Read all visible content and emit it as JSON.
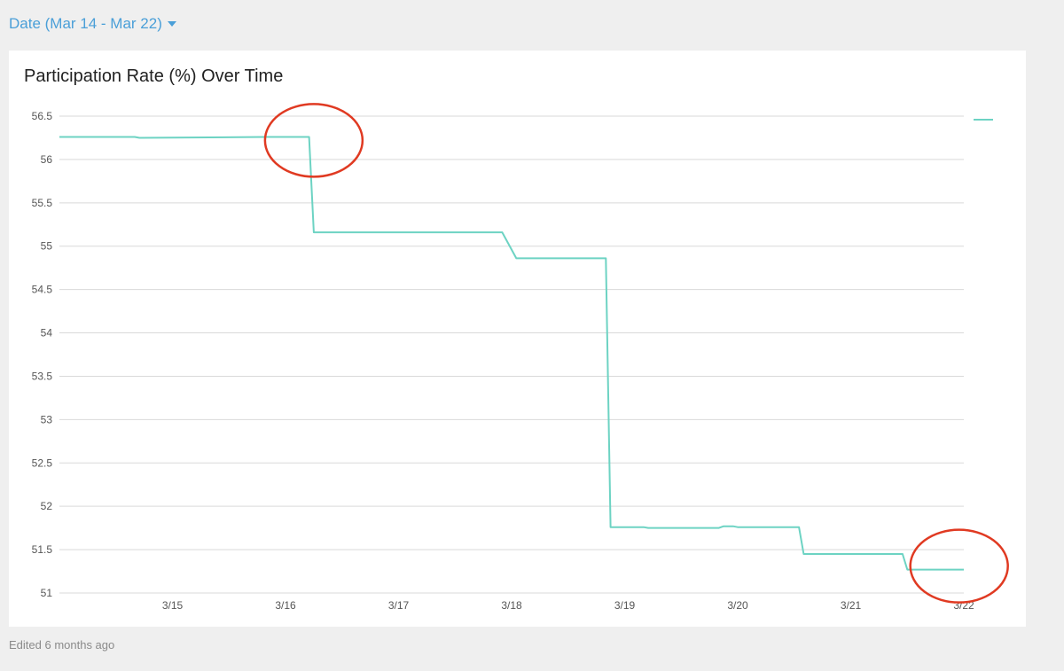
{
  "filter": {
    "label": "Date (Mar 14 - Mar 22)",
    "icon": "caret-down-icon"
  },
  "footer": {
    "edited": "Edited 6 months ago"
  },
  "colors": {
    "line": "#6dd3c3",
    "annotation": "#e03a22",
    "filter": "#4a9fd8",
    "grid": "#d9d9d9"
  },
  "chart_data": {
    "type": "line",
    "title": "Participation Rate (%) Over Time",
    "xlabel": "",
    "ylabel": "",
    "ylim": [
      51,
      56.5
    ],
    "xlim": [
      "2020-03-14T00:00",
      "2020-03-22T00:00"
    ],
    "yticks": [
      "51",
      "51.5",
      "52",
      "52.5",
      "53",
      "53.5",
      "54",
      "54.5",
      "55",
      "55.5",
      "56",
      "56.5"
    ],
    "xticks": [
      {
        "date": "2020-03-15T00:00",
        "label": "3/15"
      },
      {
        "date": "2020-03-16T00:00",
        "label": "3/16"
      },
      {
        "date": "2020-03-17T00:00",
        "label": "3/17"
      },
      {
        "date": "2020-03-18T00:00",
        "label": "3/18"
      },
      {
        "date": "2020-03-19T00:00",
        "label": "3/19"
      },
      {
        "date": "2020-03-20T00:00",
        "label": "3/20"
      },
      {
        "date": "2020-03-21T00:00",
        "label": "3/21"
      },
      {
        "date": "2020-03-22T00:00",
        "label": "3/22"
      }
    ],
    "grid": true,
    "legend": "top-right",
    "series": [
      {
        "x": [
          "2020-03-14T00:00",
          "2020-03-14T16:00",
          "2020-03-14T17:00",
          "2020-03-15T20:00",
          "2020-03-16T05:00",
          "2020-03-16T06:00",
          "2020-03-17T22:00",
          "2020-03-18T01:00",
          "2020-03-18T20:00",
          "2020-03-18T21:00",
          "2020-03-19T04:00",
          "2020-03-19T05:00",
          "2020-03-19T20:00",
          "2020-03-19T21:00",
          "2020-03-19T23:00",
          "2020-03-20T00:00",
          "2020-03-20T13:00",
          "2020-03-20T14:00",
          "2020-03-21T11:00",
          "2020-03-21T12:00",
          "2020-03-22T00:00"
        ],
        "y": [
          56.26,
          56.26,
          56.25,
          56.26,
          56.26,
          55.16,
          55.16,
          54.86,
          54.86,
          51.76,
          51.76,
          51.75,
          51.75,
          51.77,
          51.77,
          51.76,
          51.76,
          51.45,
          51.45,
          51.27,
          51.27
        ]
      }
    ],
    "annotations": [
      {
        "shape": "ellipse",
        "x": "2020-03-16T06:00",
        "y": 56.22
      },
      {
        "shape": "ellipse",
        "x": "2020-03-21T23:00",
        "y": 51.31
      }
    ]
  }
}
